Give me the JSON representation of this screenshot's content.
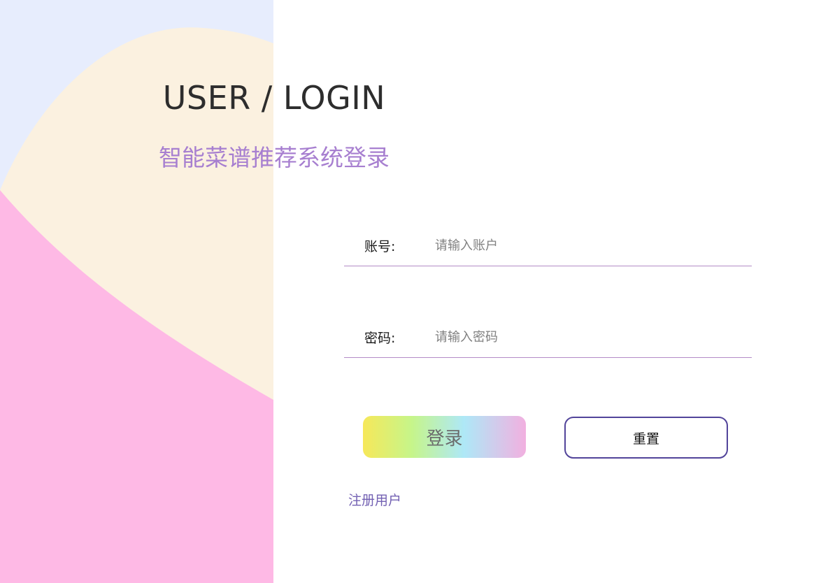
{
  "login": {
    "title": "USER / LOGIN",
    "subtitle": "智能菜谱推荐系统登录",
    "account_label": "账号:",
    "account_placeholder": "请输入账户",
    "password_label": "密码:",
    "password_placeholder": "请输入密码",
    "login_button": "登录",
    "reset_button": "重置",
    "register_link": "注册用户"
  },
  "theme": {
    "bg_top": "#e7edfd",
    "blob_cream": "#fbf1e0",
    "blob_pink": "#feb9e5",
    "subtitle_color": "#a77fd0",
    "reset_border": "#52449a",
    "link_color": "#7361b3"
  }
}
